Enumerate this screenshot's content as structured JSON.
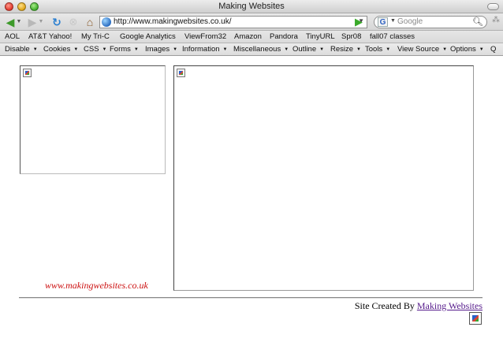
{
  "window": {
    "title": "Making Websites"
  },
  "nav": {
    "url": "http://www.makingwebsites.co.uk/",
    "search_placeholder": "Google",
    "search_engine_letter": "G"
  },
  "bookmarks": [
    "AOL",
    "AT&T Yahoo!",
    "My Tri-C",
    "Google Analytics",
    "ViewFrom32",
    "Amazon",
    "Pandora",
    "TinyURL",
    "Spr08",
    "fall07 classes"
  ],
  "devtoolbar": [
    "Disable",
    "Cookies",
    "CSS",
    "Forms",
    "Images",
    "Information",
    "Miscellaneous",
    "Outline",
    "Resize",
    "Tools",
    "View Source",
    "Options",
    "Q"
  ],
  "page": {
    "site_url": "www.makingwebsites.co.uk",
    "footer_prefix": "Site Created By",
    "footer_link": "Making Websites"
  },
  "colors": {
    "site_url_red": "#cc1111",
    "link_visited": "#551a8b"
  }
}
